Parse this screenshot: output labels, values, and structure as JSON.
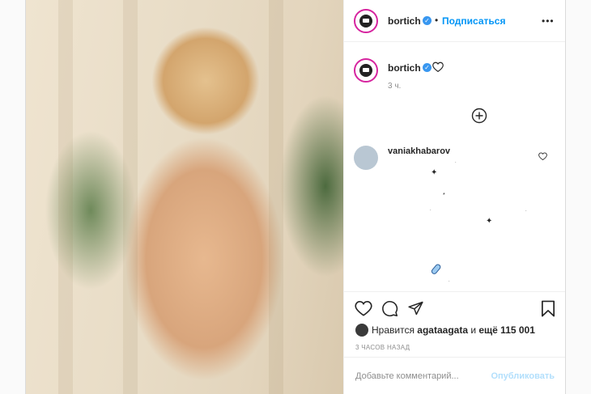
{
  "post": {
    "author": {
      "username": "bortich",
      "verified": true,
      "follow_label": "Подписаться",
      "separator": "•",
      "more": "•••"
    },
    "caption": {
      "username": "bortich",
      "time": "3 ч."
    },
    "comments": [
      {
        "username": "vaniakhabarov"
      }
    ],
    "likes": {
      "prefix": "Нравится ",
      "user": "agataagata",
      "middle": " и ",
      "count_text": "ещё 115 001"
    },
    "time_ago": "3 ЧАСОВ НАЗАД",
    "comment_input": {
      "placeholder": "Добавьте комментарий...",
      "value": ""
    },
    "publish_label": "Опубликовать",
    "colors": {
      "link": "#0095f6",
      "publish_disabled": "#b2dffc",
      "verified": "#3897f0",
      "story_ring": "#d6249f"
    },
    "icons": [
      "heart-icon",
      "comment-icon",
      "share-icon",
      "bookmark-icon",
      "more-icon",
      "add-icon",
      "sparkle-icon",
      "pill-icon"
    ]
  }
}
